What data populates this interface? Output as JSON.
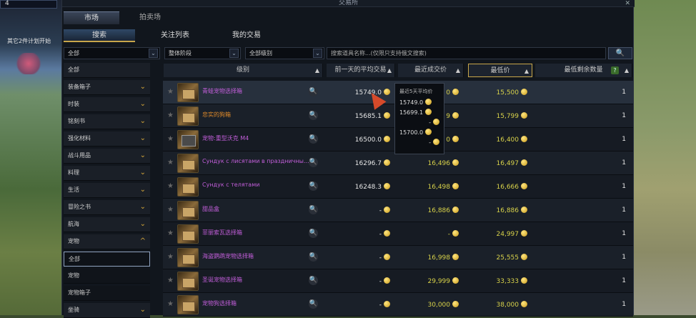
{
  "window": {
    "title": "交易所",
    "close": "✕"
  },
  "topleft": {
    "value": "4"
  },
  "sidebar_note": "其它2件计划开始",
  "tabs": [
    {
      "label": "市场"
    },
    {
      "label": "拍卖场"
    }
  ],
  "subtabs": [
    {
      "label": "搜索"
    },
    {
      "label": "关注列表"
    },
    {
      "label": "我的交易"
    }
  ],
  "filters": {
    "category": "全部",
    "stage": "整体阶段",
    "grade": "全部级别",
    "search_placeholder": "搜索道具名称...(仅限只支持俄文搜索)",
    "dropdown_arrow": "⌄"
  },
  "categories": [
    {
      "label": "全部",
      "chev": ""
    },
    {
      "label": "装备箱子",
      "chev": "⌄"
    },
    {
      "label": "时装",
      "chev": "⌄"
    },
    {
      "label": "铭刻书",
      "chev": "⌄"
    },
    {
      "label": "强化材料",
      "chev": "⌄"
    },
    {
      "label": "战斗用品",
      "chev": "⌄"
    },
    {
      "label": "料理",
      "chev": "⌄"
    },
    {
      "label": "生活",
      "chev": "⌄"
    },
    {
      "label": "冒险之书",
      "chev": "⌄"
    },
    {
      "label": "航海",
      "chev": "⌄"
    },
    {
      "label": "宠物",
      "chev": "^"
    },
    {
      "label": "全部",
      "chev": ""
    },
    {
      "label": "宠物",
      "chev": ""
    },
    {
      "label": "宠物箱子",
      "chev": ""
    },
    {
      "label": "坐骑",
      "chev": "⌄"
    }
  ],
  "table": {
    "headers": [
      {
        "label": "级别"
      },
      {
        "label": "前一天的平均交易"
      },
      {
        "label": "最近成交价"
      },
      {
        "label": "最低价"
      },
      {
        "label": "最低剩余数量"
      }
    ],
    "help": "?",
    "rows": [
      {
        "name": "青蛙宠物选择箱",
        "avg": "15749.0",
        "recent": "0",
        "lowest": "15,500",
        "qty": "1"
      },
      {
        "name": "忠实的狗箱",
        "avg": "15685.1",
        "recent": "9",
        "lowest": "15,799",
        "qty": "1"
      },
      {
        "name": "宠物:重型沃克 M4",
        "avg": "16500.0",
        "recent": "0",
        "lowest": "16,400",
        "qty": "1"
      },
      {
        "name": "Сундук с лисятами в праздничны...",
        "avg": "16296.7",
        "recent": "16,496",
        "lowest": "16,497",
        "qty": "1"
      },
      {
        "name": "Сундук с телятами",
        "avg": "16248.3",
        "recent": "16,498",
        "lowest": "16,666",
        "qty": "1"
      },
      {
        "name": "甜品盒",
        "avg": "-",
        "recent": "16,886",
        "lowest": "16,886",
        "qty": "1"
      },
      {
        "name": "菲丽索瓦选择箱",
        "avg": "-",
        "recent": "-",
        "lowest": "24,997",
        "qty": "1"
      },
      {
        "name": "海盗鹦鹉宠物选择箱",
        "avg": "-",
        "recent": "16,998",
        "lowest": "25,555",
        "qty": "1"
      },
      {
        "name": "圣诞宠物选择箱",
        "avg": "-",
        "recent": "29,999",
        "lowest": "33,333",
        "qty": "1"
      },
      {
        "name": "宠物狗选择箱",
        "avg": "-",
        "recent": "30,000",
        "lowest": "38,000",
        "qty": "1"
      }
    ]
  },
  "tooltip": {
    "title": "最近5天平均价",
    "lines": [
      "15749.0",
      "15699.1",
      "-",
      "15700.0",
      "-"
    ]
  },
  "icons": {
    "star": "★",
    "magnifier": "🔍",
    "sort_arrow": "▲",
    "chevron": "⌄"
  }
}
